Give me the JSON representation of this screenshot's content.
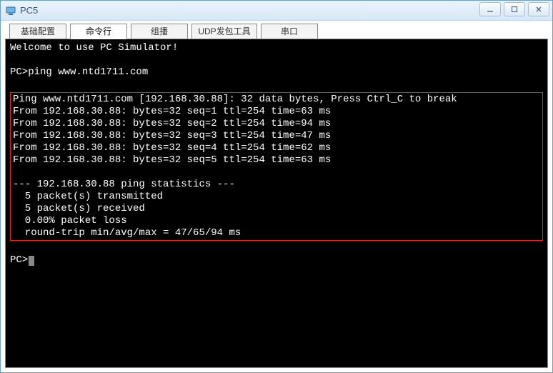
{
  "window": {
    "title": "PC5"
  },
  "tabs": {
    "basic": "基础配置",
    "cmd": "命令行",
    "multicast": "组播",
    "udp": "UDP发包工具",
    "serial": "串口"
  },
  "terminal": {
    "welcome": "Welcome to use PC Simulator!",
    "blank": "",
    "prompt_cmd": "PC>ping www.ntd1711.com",
    "highlight": {
      "l1": "Ping www.ntd1711.com [192.168.30.88]: 32 data bytes, Press Ctrl_C to break",
      "l2": "From 192.168.30.88: bytes=32 seq=1 ttl=254 time=63 ms",
      "l3": "From 192.168.30.88: bytes=32 seq=2 ttl=254 time=94 ms",
      "l4": "From 192.168.30.88: bytes=32 seq=3 ttl=254 time=47 ms",
      "l5": "From 192.168.30.88: bytes=32 seq=4 ttl=254 time=62 ms",
      "l6": "From 192.168.30.88: bytes=32 seq=5 ttl=254 time=63 ms",
      "l7": "",
      "l8": "--- 192.168.30.88 ping statistics ---",
      "l9": "  5 packet(s) transmitted",
      "l10": "  5 packet(s) received",
      "l11": "  0.00% packet loss",
      "l12": "  round-trip min/avg/max = 47/65/94 ms"
    },
    "prompt_idle": "PC>"
  }
}
